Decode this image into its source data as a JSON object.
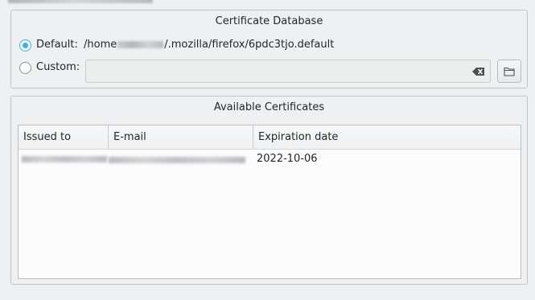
{
  "certificate_database": {
    "title": "Certificate Database",
    "default_label": "Default:",
    "default_selected": true,
    "default_path_prefix": "/home",
    "default_path_suffix": "/.mozilla/firefox/6pdc3tjo.default",
    "custom_label": "Custom:",
    "custom_selected": false,
    "custom_value": ""
  },
  "available_certificates": {
    "title": "Available Certificates",
    "columns": [
      "Issued to",
      "E-mail",
      "Expiration date"
    ],
    "rows": [
      {
        "issued_to": "",
        "email": "",
        "expiration_date": "2022-10-06"
      }
    ]
  },
  "icons": {
    "clear": "clear-text-icon",
    "folder": "folder-open-icon"
  },
  "colors": {
    "accent": "#3daee9",
    "window_bg": "#eff0f1",
    "table_bg": "#fcfcfc"
  }
}
